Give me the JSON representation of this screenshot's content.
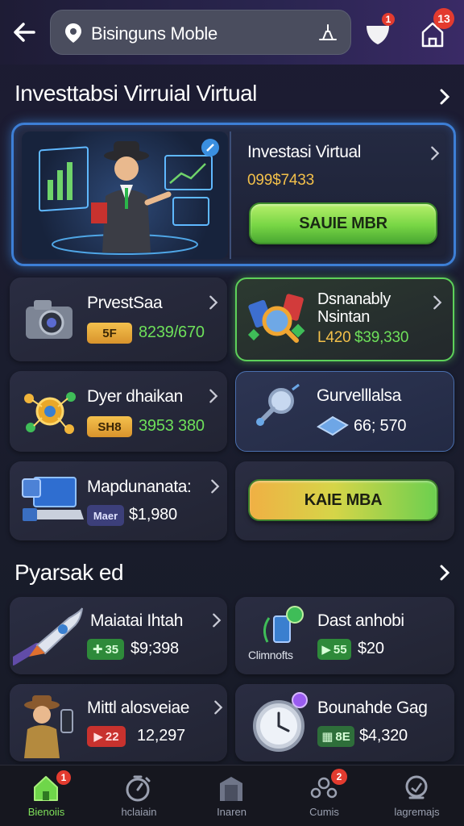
{
  "header": {
    "search_text": "Bisinguns Moble",
    "notifications_badge": "1",
    "tasks_badge": "13"
  },
  "section1": {
    "title": "Investtabsi Virruial Virtual"
  },
  "hero": {
    "title": "Investasi Virtual",
    "value": "099$7433",
    "button_label": "SAUIE MBR"
  },
  "cards": [
    {
      "title": "PrvestSaa",
      "pill": "5F",
      "value": "8239/670"
    },
    {
      "title_line1": "Dsnanably",
      "title_line2": "Nsintan",
      "value_a": "L420",
      "value_b": "$39,330"
    },
    {
      "title": "Dyer dhaikan",
      "pill": "SH8",
      "value": "3953 380"
    },
    {
      "title": "Gurvelllalsa",
      "value": "66; 570"
    },
    {
      "title": "Mapdunanata:",
      "pill": "Maer",
      "value": "$1,980"
    },
    {
      "button_label": "KAIE MBA"
    }
  ],
  "section2": {
    "title": "Pyarsak ed"
  },
  "cards2": [
    {
      "title": "Maiatai Ihtah",
      "pill": "35",
      "value": "$9;398"
    },
    {
      "title": "Dast anhobi",
      "icon_caption": "Climnofts",
      "pill": "55",
      "value": "$20"
    },
    {
      "title": "Mittl alosveiae",
      "pill": "22",
      "value": "12,297"
    },
    {
      "title": "Bounahde Gag",
      "pill": "8E",
      "value": "$4,320"
    }
  ],
  "nav": [
    {
      "label": "Bienoiis",
      "badge": "1"
    },
    {
      "label": "hclaiain"
    },
    {
      "label": "Inaren"
    },
    {
      "label": "Cumis",
      "badge": "2"
    },
    {
      "label": "lagremajs"
    }
  ],
  "colors": {
    "accent_green": "#7fe05a",
    "value_green": "#6ee05a",
    "value_yellow": "#f3c04a",
    "hero_border": "#3d7fd6",
    "badge_red": "#e33b2f"
  }
}
